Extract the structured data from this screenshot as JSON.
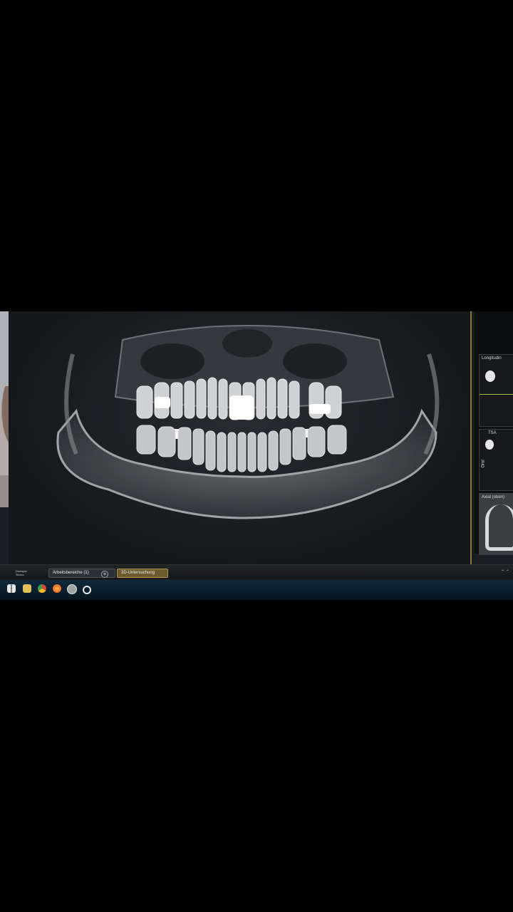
{
  "viewer": {
    "side_panels": [
      {
        "label": "Longitudin"
      },
      {
        "label": "TSA",
        "vertical_label": "Oral"
      },
      {
        "label": "Axial (oben)"
      }
    ]
  },
  "tabbar": {
    "brand_line1": "Dentsply",
    "brand_line2": "Sirona",
    "workspaces_label": "Arbeitsbereiche (1)",
    "exam_tab_label": "3D-Untersuchung",
    "close_symbol": "⊗"
  },
  "taskbar": {
    "icons": [
      "windows-start-icon",
      "file-explorer-icon",
      "chrome-icon",
      "firefox-icon",
      "app-icon",
      "c-app-icon"
    ]
  },
  "colors": {
    "accent_gold": "#b0954a",
    "taskbar": "#0e2a3d"
  }
}
